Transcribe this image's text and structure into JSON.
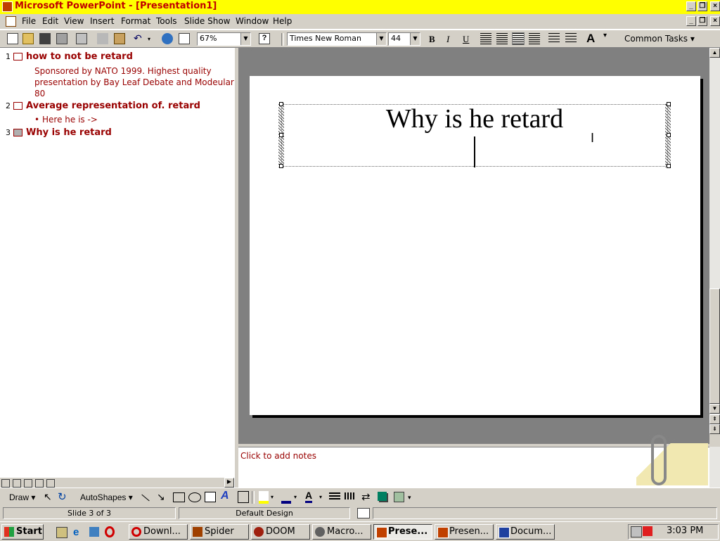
{
  "window": {
    "title": "Microsoft PowerPoint - [Presentation1]"
  },
  "menu": [
    "File",
    "Edit",
    "View",
    "Insert",
    "Format",
    "Tools",
    "Slide Show",
    "Window",
    "Help"
  ],
  "toolbar": {
    "zoom": "67%",
    "font_name": "Times New Roman",
    "font_size": "44",
    "bold": "B",
    "italic": "I",
    "underline": "U",
    "common_tasks": "Common Tasks ▾"
  },
  "outline": {
    "slides": [
      {
        "num": "1",
        "title": "how to not be retard",
        "body_lines": [
          "Sponsored by NATO 1999. Highest quality",
          "presentation by Bay Leaf Debate and Modeular",
          "80"
        ]
      },
      {
        "num": "2",
        "title": "Average representation of. retard",
        "bullet": "Here he is ->"
      },
      {
        "num": "3",
        "title": "Why is he retard"
      }
    ]
  },
  "slide": {
    "title": "Why is he retard"
  },
  "notes": {
    "placeholder": "Click to add notes"
  },
  "drawbar": {
    "draw": "Draw ▾",
    "autoshapes": "AutoShapes ▾"
  },
  "status": {
    "slide": "Slide 3 of 3",
    "design": "Default Design"
  },
  "taskbar": {
    "start": "Start",
    "buttons": [
      "Downl...",
      "Spider",
      "DOOM",
      "Macro...",
      "Prese...",
      "Presen...",
      "Docum..."
    ],
    "clock": "3:03 PM"
  },
  "colors": {
    "titlebar": "#ffff00",
    "title_text": "#c00000",
    "outline_text": "#990000"
  }
}
